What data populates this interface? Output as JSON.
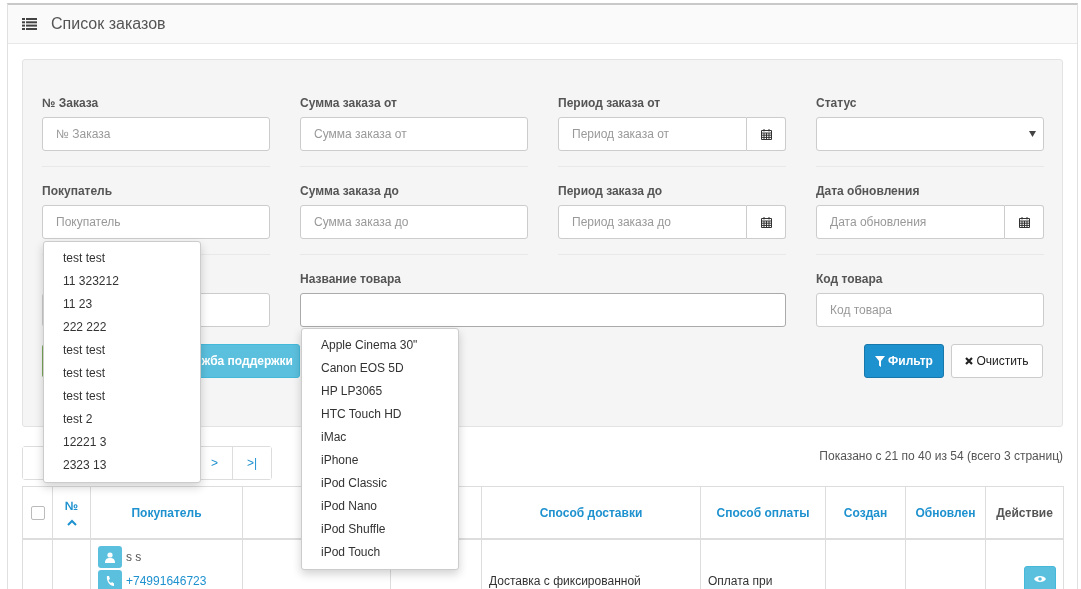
{
  "panel": {
    "title": "Список заказов"
  },
  "filter_rows": [
    [
      {
        "kind": "text",
        "label": "№ Заказа",
        "placeholder": "№ Заказа"
      },
      {
        "kind": "text",
        "label": "Сумма заказа от",
        "placeholder": "Сумма заказа от"
      },
      {
        "kind": "date",
        "label": "Период заказа от",
        "placeholder": "Период заказа от"
      },
      {
        "kind": "select",
        "label": "Статус"
      }
    ],
    [
      {
        "kind": "text",
        "label": "Покупатель",
        "placeholder": "Покупатель"
      },
      {
        "kind": "text",
        "label": "Сумма заказа до",
        "placeholder": "Сумма заказа до"
      },
      {
        "kind": "date",
        "label": "Период заказа до",
        "placeholder": "Период заказа до"
      },
      {
        "kind": "date",
        "label": "Дата обновления",
        "placeholder": "Дата обновления"
      }
    ],
    [
      {
        "kind": "text"
      },
      {
        "kind": "wide",
        "label": "Название товара"
      },
      {
        "kind": "text",
        "label": "Код товара",
        "placeholder": "Код товара"
      }
    ]
  ],
  "left_buttons": [
    {
      "kind": "success"
    },
    {
      "kind": "info",
      "label": "жба поддержки"
    }
  ],
  "right_buttons": [
    {
      "kind": "primary",
      "label": "Фильтр"
    },
    {
      "kind": "default",
      "label": "Очистить"
    }
  ],
  "customer_suggestions": [
    "test test",
    "11 323212",
    "11 23",
    "222 222",
    "test test",
    "test test",
    "test test",
    "test 2",
    "12221 3",
    "2323 13"
  ],
  "product_suggestions": [
    "Apple Cinema 30\"",
    "Canon EOS 5D",
    "HP LP3065",
    "HTC Touch HD",
    "iMac",
    "iPhone",
    "iPod Classic",
    "iPod Nano",
    "iPod Shuffle",
    "iPod Touch"
  ],
  "pagination": [
    {
      "kind": "covered"
    },
    {
      "kind": "link",
      "label": ">"
    },
    {
      "kind": "link",
      "label": ">|"
    }
  ],
  "summary": "Показано с 21 по 40 из 54 (всего 3 страниц)",
  "table": {
    "select_all": {
      "checked": false
    },
    "columns": [
      {
        "kind": "checkbox"
      },
      {
        "kind": "sort",
        "label": "№",
        "sorted": true
      },
      {
        "kind": "sort",
        "label": "Покупатель",
        "sorted": false
      },
      {
        "kind": "covered"
      },
      {
        "kind": "covered"
      },
      {
        "kind": "sort",
        "label": "Способ доставки",
        "sorted": false
      },
      {
        "kind": "sort",
        "label": "Способ оплаты",
        "sorted": false
      },
      {
        "kind": "sort",
        "label": "Создан",
        "sorted": false
      },
      {
        "kind": "sort",
        "label": "Обновлен",
        "sorted": false
      },
      {
        "kind": "plain",
        "label": "Действие"
      }
    ],
    "rows": [
      {
        "customer": "s s",
        "phone": "+74991646723",
        "shipping": "Доставка с фиксированной",
        "payment": "Оплата при"
      }
    ]
  }
}
